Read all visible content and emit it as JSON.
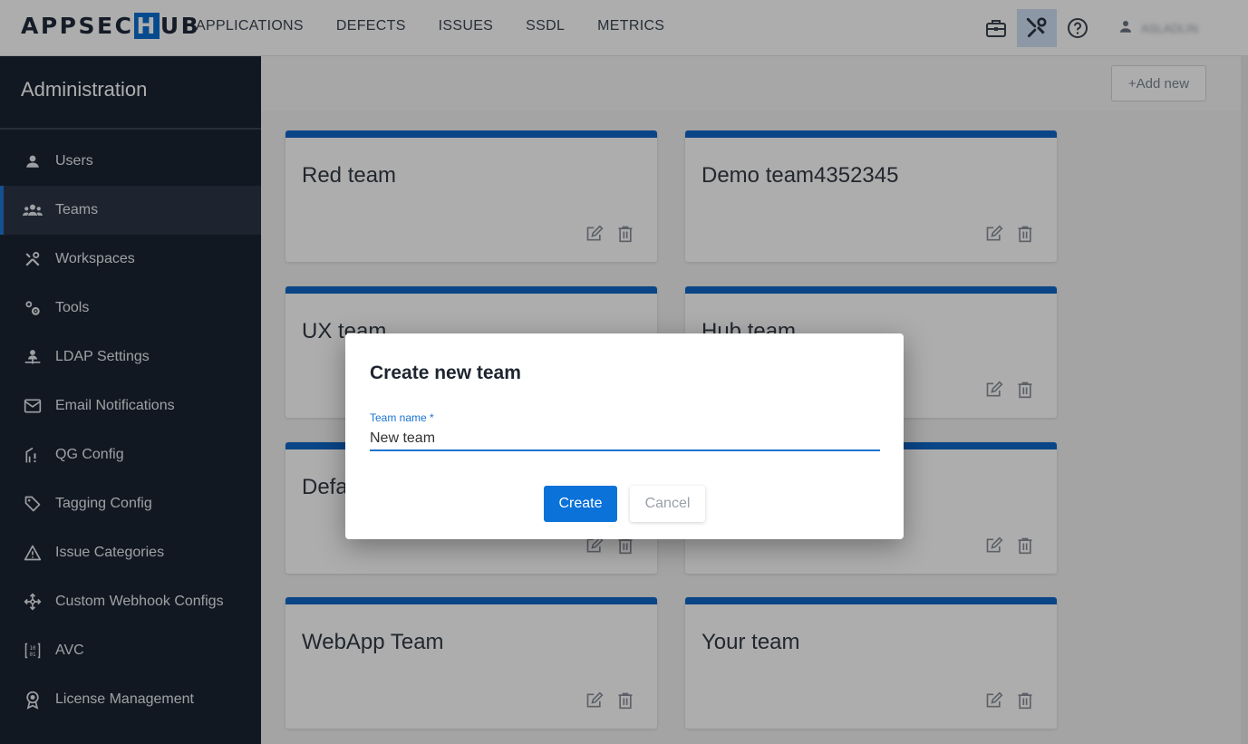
{
  "app": {
    "logo_left": "APPSEC",
    "logo_h": "H",
    "logo_right": "UB"
  },
  "nav": {
    "items": [
      "APPLICATIONS",
      "DEFECTS",
      "ISSUES",
      "SSDL",
      "METRICS"
    ]
  },
  "user": {
    "name": "ASLADLIN"
  },
  "sidebar": {
    "title": "Administration",
    "items": [
      {
        "label": "Users",
        "icon": "person-icon"
      },
      {
        "label": "Teams",
        "icon": "group-icon",
        "active": true
      },
      {
        "label": "Workspaces",
        "icon": "tools-icon"
      },
      {
        "label": "Tools",
        "icon": "gears-icon"
      },
      {
        "label": "LDAP Settings",
        "icon": "ldap-icon"
      },
      {
        "label": "Email Notifications",
        "icon": "mail-icon"
      },
      {
        "label": "QG Config",
        "icon": "gate-icon"
      },
      {
        "label": "Tagging Config",
        "icon": "tag-icon"
      },
      {
        "label": "Issue Categories",
        "icon": "warning-icon"
      },
      {
        "label": "Custom Webhook Configs",
        "icon": "webhook-icon"
      },
      {
        "label": "AVC",
        "icon": "binary-icon"
      },
      {
        "label": "License Management",
        "icon": "badge-icon"
      }
    ]
  },
  "main": {
    "add_new_label": "+Add new",
    "teams": [
      "Red team",
      "Demo team4352345",
      "UX team",
      "Hub team",
      "Defa",
      "",
      "WebApp Team",
      "Your team"
    ]
  },
  "modal": {
    "title": "Create new team",
    "field_label": "Team name *",
    "field_value": "New team",
    "create_label": "Create",
    "cancel_label": "Cancel"
  },
  "colors": {
    "accent": "#1066c8",
    "sidebar_bg": "#1b2433",
    "primary_button": "#0a72d9"
  }
}
